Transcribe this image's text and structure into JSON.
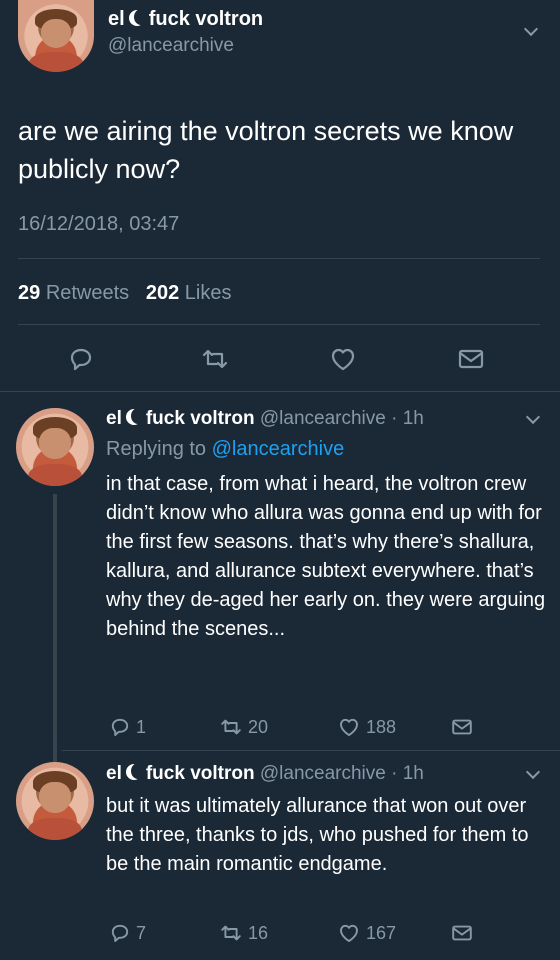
{
  "main": {
    "display_name": "el",
    "display_name_suffix": "fuck voltron",
    "handle": "@lancearchive",
    "text": "are we airing the voltron secrets we know publicly now?",
    "timestamp": "16/12/2018, 03:47",
    "retweets_count": "29",
    "retweets_label": "Retweets",
    "likes_count": "202",
    "likes_label": "Likes"
  },
  "replies": [
    {
      "display_name": "el",
      "display_name_suffix": "fuck voltron",
      "handle": "@lancearchive",
      "time": "· 1h",
      "replying_prefix": "Replying to",
      "replying_handle": "@lancearchive",
      "text": "in that case, from what i heard, the voltron crew didn’t know who allura was gonna end up with for the first few seasons. that’s why there’s shallura, kallura, and allurance subtext everywhere. that’s why they de-aged her early on. they were arguing behind the scenes...",
      "reply_count": "1",
      "retweet_count": "20",
      "like_count": "188"
    },
    {
      "display_name": "el",
      "display_name_suffix": "fuck voltron",
      "handle": "@lancearchive",
      "time": "· 1h",
      "text": "but it was ultimately allurance that won out over the three, thanks to jds, who pushed for them to be the main romantic endgame.",
      "reply_count": "7",
      "retweet_count": "16",
      "like_count": "167"
    }
  ],
  "icons": [
    "reply-icon",
    "retweet-icon",
    "like-icon",
    "dm-icon",
    "chevron-down-icon",
    "moon-icon"
  ],
  "colors": {
    "background": "#1b2836",
    "text": "#ffffff",
    "muted": "#8899a6",
    "link": "#1da1f2",
    "divider": "#38444d"
  }
}
